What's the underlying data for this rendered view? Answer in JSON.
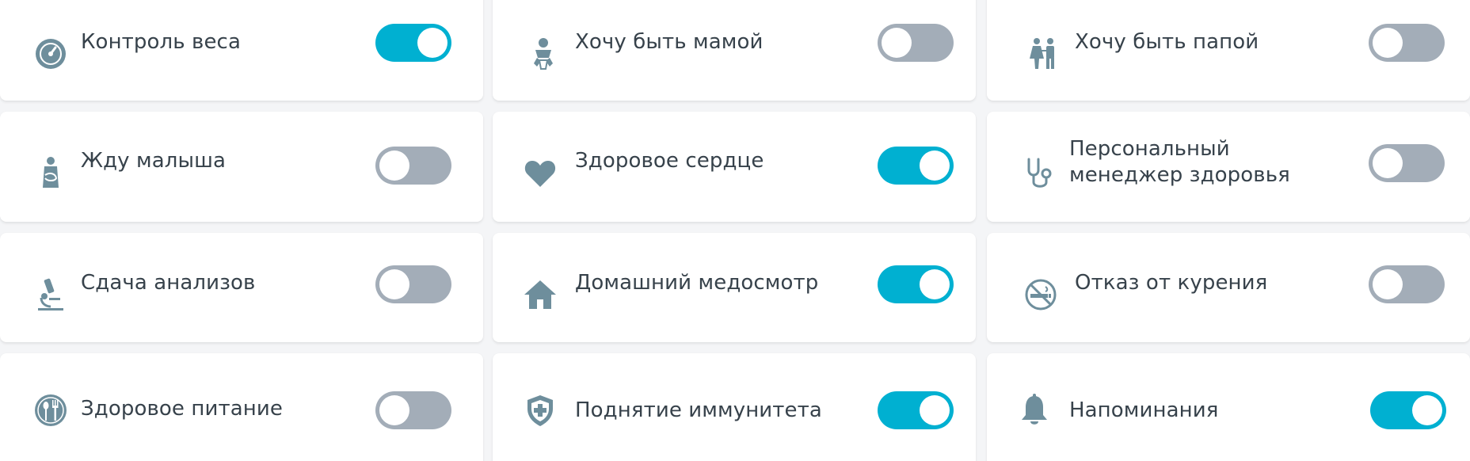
{
  "colors": {
    "toggle_on": "#00b0d1",
    "toggle_off": "#a3adb8",
    "icon": "#6e8e9c",
    "text": "#37424b"
  },
  "items": [
    {
      "label": "Контроль веса",
      "icon": "gauge-icon",
      "enabled": true
    },
    {
      "label": "Хочу быть мамой",
      "icon": "baby-icon",
      "enabled": false
    },
    {
      "label": "Хочу быть папой",
      "icon": "family-icon",
      "enabled": false
    },
    {
      "label": "Жду малыша",
      "icon": "pregnant-icon",
      "enabled": false
    },
    {
      "label": "Здоровое сердце",
      "icon": "heart-icon",
      "enabled": true
    },
    {
      "label": "Персональный менеджер здоровья",
      "icon": "stethoscope-icon",
      "enabled": false
    },
    {
      "label": "Сдача анализов",
      "icon": "microscope-icon",
      "enabled": false
    },
    {
      "label": "Домашний медосмотр",
      "icon": "home-icon",
      "enabled": true
    },
    {
      "label": "Отказ от курения",
      "icon": "no-smoking-icon",
      "enabled": false
    },
    {
      "label": "Здоровое питание",
      "icon": "fork-spoon-icon",
      "enabled": false
    },
    {
      "label": "Поднятие иммунитета",
      "icon": "shield-cross-icon",
      "enabled": true
    },
    {
      "label": "Напоминания",
      "icon": "bell-icon",
      "enabled": true
    }
  ]
}
